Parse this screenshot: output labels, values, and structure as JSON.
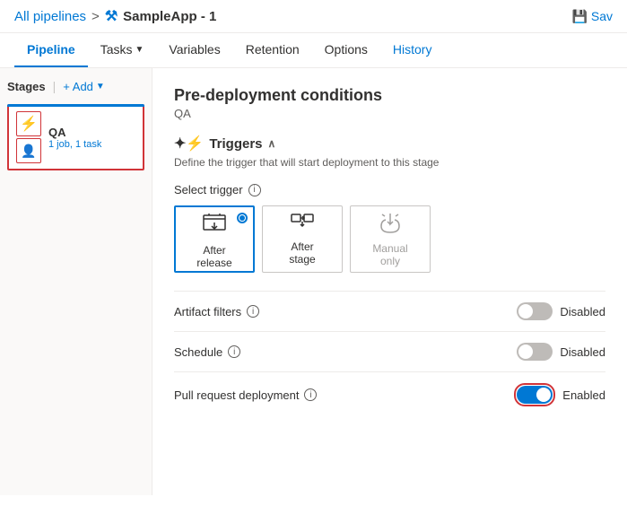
{
  "breadcrumb": {
    "all_pipelines": "All pipelines",
    "separator": ">",
    "app_name": "SampleApp - 1"
  },
  "save_button": "Sav",
  "nav": {
    "tabs": [
      {
        "id": "pipeline",
        "label": "Pipeline",
        "active": true
      },
      {
        "id": "tasks",
        "label": "Tasks",
        "has_arrow": true
      },
      {
        "id": "variables",
        "label": "Variables"
      },
      {
        "id": "retention",
        "label": "Retention"
      },
      {
        "id": "options",
        "label": "Options"
      },
      {
        "id": "history",
        "label": "History"
      }
    ]
  },
  "sidebar": {
    "stages_label": "Stages",
    "add_label": "+ Add",
    "stage": {
      "name": "QA",
      "meta": "1 job, 1 task"
    }
  },
  "panel": {
    "title": "Pre-deployment conditions",
    "subtitle": "QA",
    "triggers_section": "Triggers",
    "triggers_desc": "Define the trigger that will start deployment to this stage",
    "select_trigger_label": "Select trigger",
    "trigger_options": [
      {
        "id": "after_release",
        "label": "After\nrelease",
        "selected": true,
        "disabled": false
      },
      {
        "id": "after_stage",
        "label": "After\nstage",
        "selected": false,
        "disabled": false
      },
      {
        "id": "manual_only",
        "label": "Manual\nonly",
        "selected": false,
        "disabled": true
      }
    ],
    "settings": [
      {
        "id": "artifact_filters",
        "label": "Artifact filters",
        "status": "Disabled",
        "enabled": false
      },
      {
        "id": "schedule",
        "label": "Schedule",
        "status": "Disabled",
        "enabled": false
      },
      {
        "id": "pull_request",
        "label": "Pull request deployment",
        "status": "Enabled",
        "enabled": true,
        "highlighted": true
      }
    ]
  }
}
